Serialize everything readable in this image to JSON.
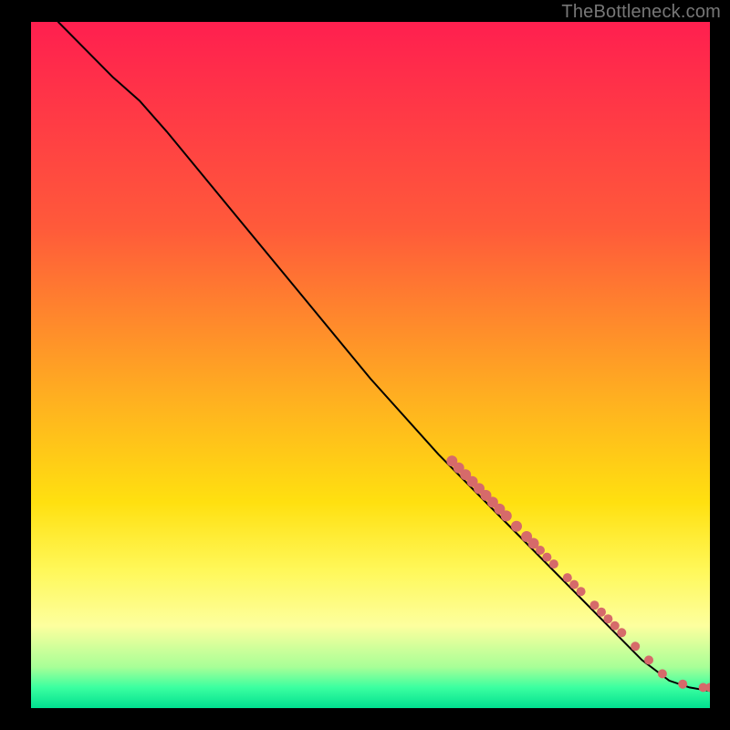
{
  "watermark": "TheBottleneck.com",
  "chart_data": {
    "type": "line",
    "title": "",
    "xlabel": "",
    "ylabel": "",
    "xlim": [
      0,
      100
    ],
    "ylim": [
      0,
      100
    ],
    "grid": false,
    "gradient_stops": [
      {
        "offset": 0,
        "color": "#ff1f4f"
      },
      {
        "offset": 30,
        "color": "#ff5a3a"
      },
      {
        "offset": 55,
        "color": "#ffb020"
      },
      {
        "offset": 70,
        "color": "#ffe010"
      },
      {
        "offset": 80,
        "color": "#fff85a"
      },
      {
        "offset": 88,
        "color": "#fdff9e"
      },
      {
        "offset": 94,
        "color": "#a8ff97"
      },
      {
        "offset": 97,
        "color": "#3bffa0"
      },
      {
        "offset": 100,
        "color": "#00e090"
      }
    ],
    "series": [
      {
        "name": "curve",
        "stroke": "#000000",
        "points": [
          {
            "x": 4,
            "y": 100
          },
          {
            "x": 8,
            "y": 96
          },
          {
            "x": 12,
            "y": 92
          },
          {
            "x": 16,
            "y": 88.5
          },
          {
            "x": 20,
            "y": 84
          },
          {
            "x": 30,
            "y": 72
          },
          {
            "x": 40,
            "y": 60
          },
          {
            "x": 50,
            "y": 48
          },
          {
            "x": 60,
            "y": 37
          },
          {
            "x": 70,
            "y": 27
          },
          {
            "x": 80,
            "y": 17
          },
          {
            "x": 86,
            "y": 11
          },
          {
            "x": 90,
            "y": 7
          },
          {
            "x": 94,
            "y": 4
          },
          {
            "x": 97,
            "y": 3
          },
          {
            "x": 100,
            "y": 2.5
          }
        ]
      }
    ],
    "markers": {
      "color": "#d66a6a",
      "radius_small": 5,
      "radius_large": 6,
      "points": [
        {
          "x": 62,
          "y": 36
        },
        {
          "x": 63,
          "y": 35
        },
        {
          "x": 64,
          "y": 34
        },
        {
          "x": 65,
          "y": 33
        },
        {
          "x": 66,
          "y": 32
        },
        {
          "x": 67,
          "y": 31
        },
        {
          "x": 68,
          "y": 30
        },
        {
          "x": 69,
          "y": 29
        },
        {
          "x": 70,
          "y": 28
        },
        {
          "x": 71.5,
          "y": 26.5
        },
        {
          "x": 73,
          "y": 25
        },
        {
          "x": 74,
          "y": 24
        },
        {
          "x": 75,
          "y": 23
        },
        {
          "x": 76,
          "y": 22
        },
        {
          "x": 77,
          "y": 21
        },
        {
          "x": 79,
          "y": 19
        },
        {
          "x": 80,
          "y": 18
        },
        {
          "x": 81,
          "y": 17
        },
        {
          "x": 83,
          "y": 15
        },
        {
          "x": 84,
          "y": 14
        },
        {
          "x": 85,
          "y": 13
        },
        {
          "x": 86,
          "y": 12
        },
        {
          "x": 87,
          "y": 11
        },
        {
          "x": 89,
          "y": 9
        },
        {
          "x": 91,
          "y": 7
        },
        {
          "x": 93,
          "y": 5
        },
        {
          "x": 96,
          "y": 3.5
        },
        {
          "x": 99,
          "y": 3
        },
        {
          "x": 100,
          "y": 3
        }
      ]
    }
  }
}
